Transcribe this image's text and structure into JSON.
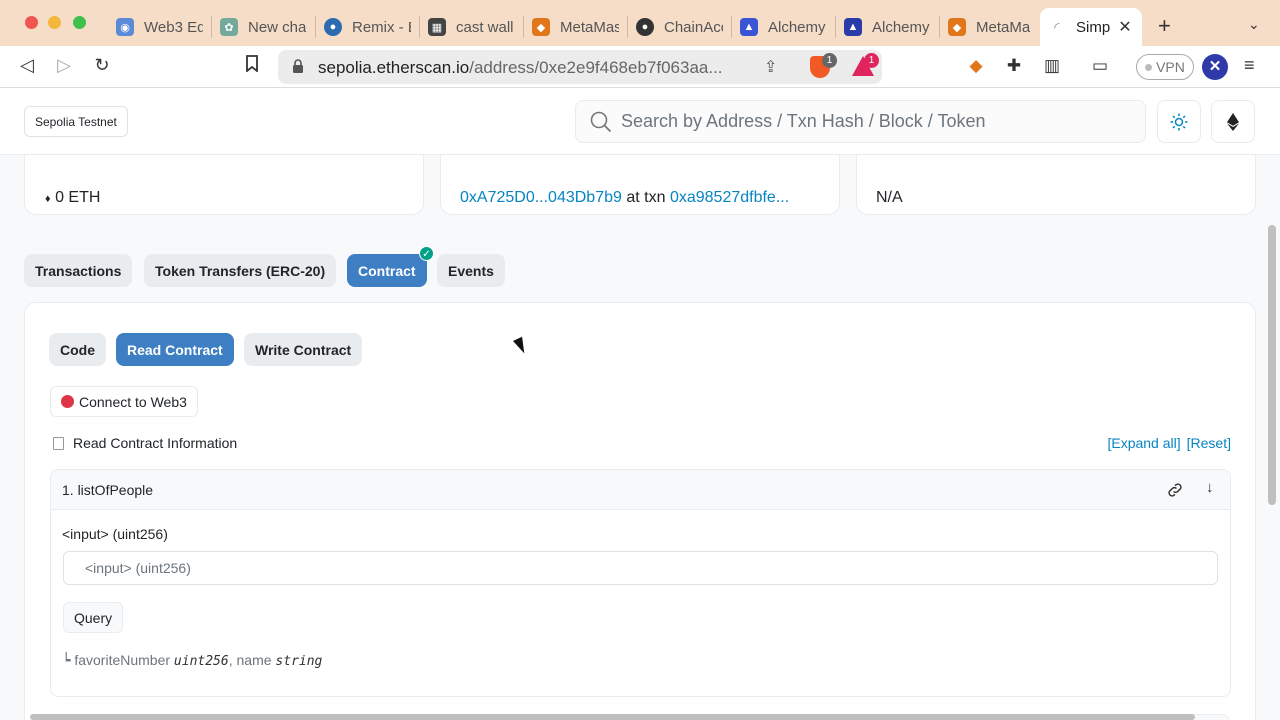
{
  "browser": {
    "tabs": [
      {
        "label": "Web3 Ed",
        "icon": "globe-icon",
        "color": "#5b8bd6"
      },
      {
        "label": "New cha",
        "icon": "chatgpt-icon",
        "color": "#74aa9c"
      },
      {
        "label": "Remix - E",
        "icon": "remix-icon",
        "color": "#2b6cb0"
      },
      {
        "label": "cast wall",
        "icon": "foundry-icon",
        "color": "#444444"
      },
      {
        "label": "MetaMas",
        "icon": "metamask-icon",
        "color": "#e2761b"
      },
      {
        "label": "ChainAcc",
        "icon": "github-icon",
        "color": "#333333"
      },
      {
        "label": "Alchemy",
        "icon": "alchemy-icon",
        "color": "#3a54d6"
      },
      {
        "label": "Alchemy",
        "icon": "alchemy-icon",
        "color": "#2a3ca8"
      },
      {
        "label": "MetaMas",
        "icon": "metamask-icon",
        "color": "#e2761b"
      }
    ],
    "active_tab": {
      "label": "Simp",
      "close": "✕"
    },
    "new_tab": "+",
    "url": {
      "host": "sepolia.etherscan.io",
      "path": "/address/0xe2e9f468eb7f063aa..."
    },
    "brave_badge": "1",
    "rewards_badge": "1",
    "vpn_label": "VPN"
  },
  "header": {
    "network": "Sepolia Testnet",
    "search_placeholder": "Search by Address / Txn Hash / Block / Token"
  },
  "overview": {
    "balance": "0 ETH",
    "creator_address": "0xA725D0...043Db7b9",
    "creator_at": "at txn",
    "creator_txn": "0xa98527dfbfe...",
    "token_tracker": "N/A"
  },
  "tabs": [
    {
      "label": "Transactions"
    },
    {
      "label": "Token Transfers (ERC-20)"
    },
    {
      "label": "Contract",
      "active": true
    },
    {
      "label": "Events"
    }
  ],
  "contract": {
    "subtabs": [
      {
        "label": "Code"
      },
      {
        "label": "Read Contract",
        "active": true
      },
      {
        "label": "Write Contract"
      }
    ],
    "connect_label": "Connect to Web3",
    "info_label": "Read Contract Information",
    "expand_all": "[Expand all]",
    "reset": "[Reset]",
    "function": {
      "title": "1. listOfPeople",
      "param_label": "<input> (uint256)",
      "param_placeholder": "<input> (uint256)",
      "query_label": "Query",
      "return_prefix": "┕",
      "return_name1": "favoriteNumber",
      "return_type1": "uint256",
      "return_sep": ", name",
      "return_type2": "string"
    }
  }
}
